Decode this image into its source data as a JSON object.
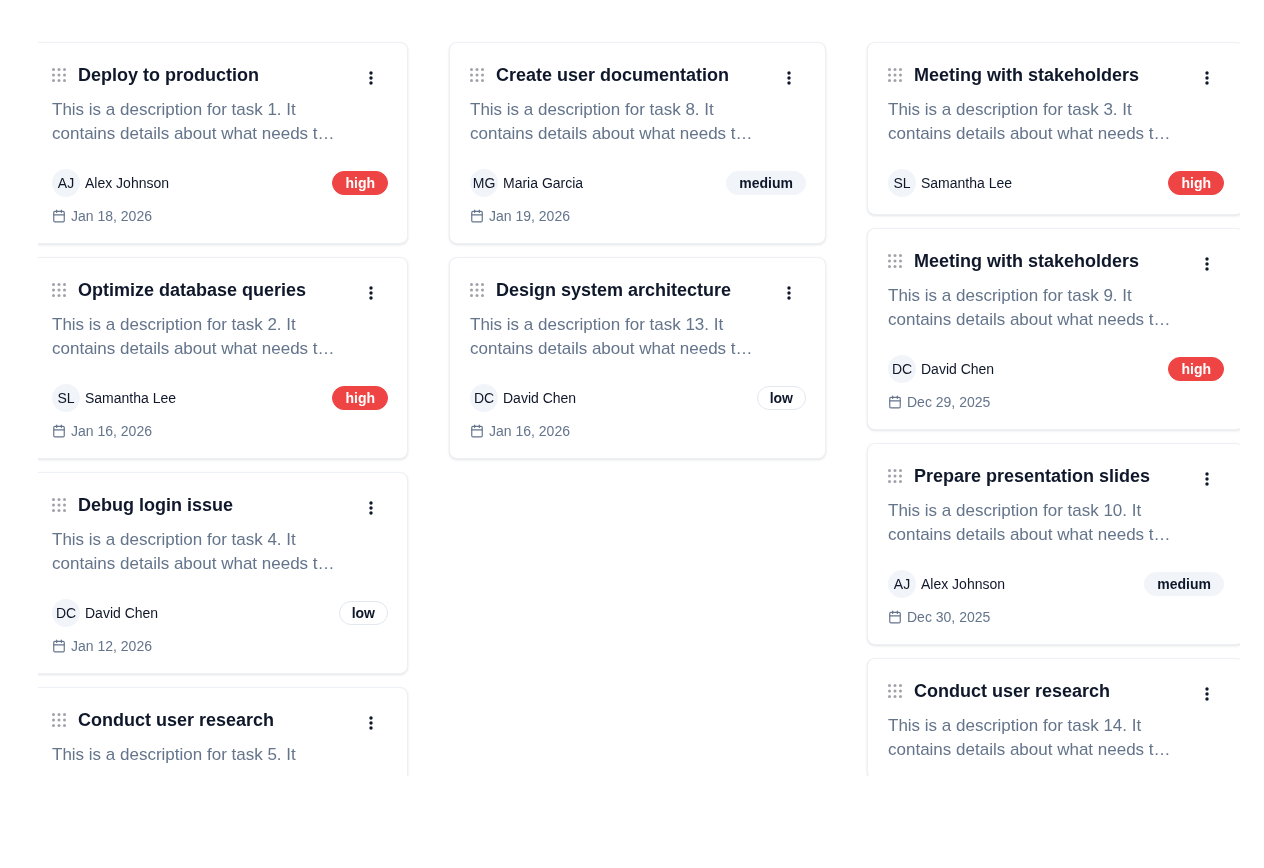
{
  "columns": [
    {
      "cards": [
        {
          "title": "Deploy to production",
          "description": "This is a description for task 1. It contains details about what needs t…",
          "assignee": {
            "initials": "AJ",
            "name": "Alex Johnson"
          },
          "priority": {
            "label": "high",
            "kind": "destructive"
          },
          "due_date": "Jan 18, 2026"
        },
        {
          "title": "Optimize database queries",
          "description": "This is a description for task 2. It contains details about what needs t…",
          "assignee": {
            "initials": "SL",
            "name": "Samantha Lee"
          },
          "priority": {
            "label": "high",
            "kind": "destructive"
          },
          "due_date": "Jan 16, 2026"
        },
        {
          "title": "Debug login issue",
          "description": "This is a description for task 4. It contains details about what needs t…",
          "assignee": {
            "initials": "DC",
            "name": "David Chen"
          },
          "priority": {
            "label": "low",
            "kind": "outline"
          },
          "due_date": "Jan 12, 2026"
        },
        {
          "title": "Conduct user research",
          "description": "This is a description for task 5. It"
        }
      ]
    },
    {
      "cards": [
        {
          "title": "Create user documentation",
          "description": "This is a description for task 8. It contains details about what needs t…",
          "assignee": {
            "initials": "MG",
            "name": "Maria Garcia"
          },
          "priority": {
            "label": "medium",
            "kind": "secondary"
          },
          "due_date": "Jan 19, 2026"
        },
        {
          "title": "Design system architecture",
          "description": "This is a description for task 13. It contains details about what needs t…",
          "assignee": {
            "initials": "DC",
            "name": "David Chen"
          },
          "priority": {
            "label": "low",
            "kind": "outline"
          },
          "due_date": "Jan 16, 2026"
        }
      ]
    },
    {
      "cards": [
        {
          "title": "Meeting with stakeholders",
          "description": "This is a description for task 3. It contains details about what needs t…",
          "assignee": {
            "initials": "SL",
            "name": "Samantha Lee"
          },
          "priority": {
            "label": "high",
            "kind": "destructive"
          }
        },
        {
          "title": "Meeting with stakeholders",
          "description": "This is a description for task 9. It contains details about what needs t…",
          "assignee": {
            "initials": "DC",
            "name": "David Chen"
          },
          "priority": {
            "label": "high",
            "kind": "destructive"
          },
          "due_date": "Dec 29, 2025"
        },
        {
          "title": "Prepare presentation slides",
          "description": "This is a description for task 10. It contains details about what needs t…",
          "assignee": {
            "initials": "AJ",
            "name": "Alex Johnson"
          },
          "priority": {
            "label": "medium",
            "kind": "secondary"
          },
          "due_date": "Dec 30, 2025"
        },
        {
          "title": "Conduct user research",
          "description": "This is a description for task 14. It contains details about what needs t…"
        }
      ]
    }
  ]
}
